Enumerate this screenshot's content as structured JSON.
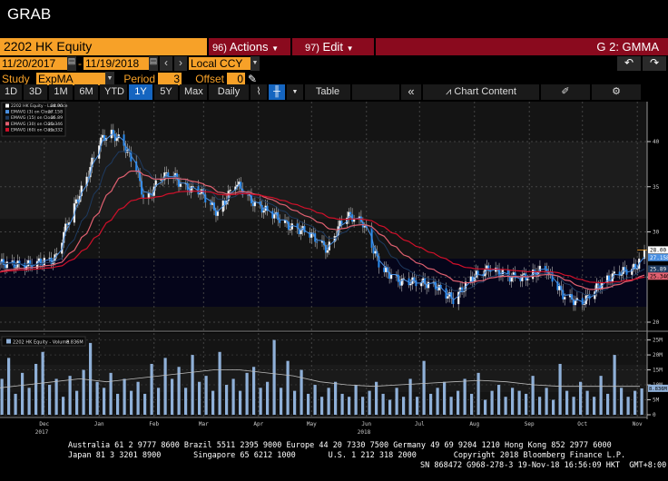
{
  "window_title": "GRAB",
  "header": {
    "ticker": "2202 HK Equity",
    "actions_num": "96)",
    "actions_label": "Actions",
    "edit_num": "97)",
    "edit_label": "Edit",
    "function": "G 2: GMMA"
  },
  "range": {
    "start": "11/20/2017",
    "dash": "-",
    "end": "11/19/2018",
    "currency": "Local CCY"
  },
  "study": {
    "label": "Study",
    "value": "ExpMA",
    "period_label": "Period",
    "period": "3",
    "offset_label": "Offset",
    "offset": "0"
  },
  "toolbar": {
    "periods": [
      "1D",
      "3D",
      "1M",
      "6M",
      "YTD",
      "1Y",
      "5Y",
      "Max"
    ],
    "selected": "1Y",
    "frequency": "Daily ▼",
    "table": "Table",
    "collapse": "«",
    "chart_content": "Chart Content"
  },
  "legend": {
    "items": [
      {
        "label": "2202 HK Equity - Last Price",
        "value": "28.00",
        "color": "#ffffff"
      },
      {
        "label": "EMAVG (3) on Close",
        "value": "27.158",
        "color": "#4a90e2"
      },
      {
        "label": "EMAVG (15) on Close",
        "value": "25.89",
        "color": "#1e3a5f"
      },
      {
        "label": "EMAVG (30) on Close",
        "value": "25.346",
        "color": "#e06070"
      },
      {
        "label": "EMAVG (60) on Close",
        "value": "25.332",
        "color": "#d0102a"
      }
    ]
  },
  "volume_legend": {
    "label": "2202 HK Equity - Volume",
    "value": "8.836M",
    "color": "#8fb0d8"
  },
  "chart_data": {
    "type": "candlestick",
    "price_axis": {
      "ticks": [
        "20",
        "25",
        "30",
        "35",
        "40"
      ],
      "ylim": [
        19,
        43
      ]
    },
    "volume_axis": {
      "ticks": [
        "0",
        "5M",
        "10M",
        "15M",
        "20M",
        "25M"
      ],
      "ylim": [
        0,
        27
      ]
    },
    "x_labels": [
      {
        "m": "Dec",
        "y": "2017",
        "d": "2017-12-15"
      },
      {
        "m": "Jan",
        "d": "2018-01-15"
      },
      {
        "m": "Feb",
        "d": "2018-02-15"
      },
      {
        "m": "Mar",
        "d": "2018-03-15"
      },
      {
        "m": "Apr",
        "d": "2018-04-15"
      },
      {
        "m": "May",
        "d": "2018-05-15"
      },
      {
        "m": "Jun",
        "y": "2018",
        "d": "2018-06-15"
      },
      {
        "m": "Jul",
        "d": "2018-07-15"
      },
      {
        "m": "Aug",
        "d": "2018-08-15"
      },
      {
        "m": "Sep",
        "d": "2018-09-15"
      },
      {
        "m": "Oct",
        "d": "2018-10-15"
      },
      {
        "m": "Nov",
        "d": "2018-11-15"
      }
    ],
    "x_range": [
      "2017-11-20",
      "2018-11-19"
    ],
    "close": [
      [
        "2017-11-20",
        26.5
      ],
      [
        "2017-12-05",
        26.3
      ],
      [
        "2017-12-21",
        27
      ],
      [
        "2017-12-28",
        31
      ],
      [
        "2018-01-08",
        36
      ],
      [
        "2018-01-15",
        40
      ],
      [
        "2018-01-21",
        41
      ],
      [
        "2018-01-28",
        40
      ],
      [
        "2018-02-05",
        37
      ],
      [
        "2018-02-10",
        33
      ],
      [
        "2018-02-18",
        36
      ],
      [
        "2018-02-25",
        36.5
      ],
      [
        "2018-03-03",
        35
      ],
      [
        "2018-03-13",
        34.5
      ],
      [
        "2018-03-23",
        32
      ],
      [
        "2018-04-02",
        35.5
      ],
      [
        "2018-04-13",
        33
      ],
      [
        "2018-04-23",
        32
      ],
      [
        "2018-05-03",
        30.5
      ],
      [
        "2018-05-13",
        30
      ],
      [
        "2018-05-24",
        28
      ],
      [
        "2018-06-03",
        32
      ],
      [
        "2018-06-13",
        31
      ],
      [
        "2018-06-23",
        26
      ],
      [
        "2018-07-04",
        24.5
      ],
      [
        "2018-07-14",
        24.5
      ],
      [
        "2018-07-24",
        24
      ],
      [
        "2018-08-03",
        22.5
      ],
      [
        "2018-08-14",
        25
      ],
      [
        "2018-08-24",
        26
      ],
      [
        "2018-09-03",
        25
      ],
      [
        "2018-09-13",
        25
      ],
      [
        "2018-09-24",
        26
      ],
      [
        "2018-10-04",
        23
      ],
      [
        "2018-10-14",
        22
      ],
      [
        "2018-10-24",
        24
      ],
      [
        "2018-11-04",
        25.5
      ],
      [
        "2018-11-14",
        26
      ],
      [
        "2018-11-19",
        28
      ]
    ],
    "volume_M": [
      12,
      19,
      7,
      14,
      9,
      17,
      21,
      10,
      12,
      6,
      13,
      8,
      15,
      24,
      11,
      9,
      14,
      7,
      12,
      8,
      11,
      7,
      17,
      9,
      19,
      12,
      16,
      9,
      20,
      11,
      13,
      8,
      21,
      10,
      12,
      8,
      14,
      16,
      9,
      11,
      25,
      9,
      18,
      8,
      15,
      7,
      10,
      6,
      9,
      11,
      7,
      6,
      10,
      6,
      8,
      11,
      7,
      5,
      9,
      6,
      12,
      6,
      18,
      7,
      9,
      11,
      6,
      8,
      12,
      7,
      14,
      5,
      8,
      10,
      6,
      9,
      8,
      7,
      13,
      6,
      9,
      5,
      17,
      8,
      6,
      11,
      8,
      6,
      13,
      7,
      20,
      9,
      6,
      8,
      8.8
    ],
    "volume_ma_M": [
      9,
      10,
      11,
      12,
      11,
      12,
      13,
      14,
      15,
      15,
      14,
      13,
      11,
      10,
      9.5,
      10,
      10.5,
      11,
      11.5,
      11,
      10,
      9.5,
      9.5,
      9.5,
      9.5
    ]
  },
  "footer": {
    "line1": "Australia 61 2 9777 8600 Brazil 5511 2395 9000 Europe 44 20 7330 7500 Germany 49 69 9204 1210 Hong Kong 852 2977 6000",
    "line2": "Japan 81 3 3201 8900       Singapore 65 6212 1000       U.S. 1 212 318 2000        Copyright 2018 Bloomberg Finance L.P.",
    "line3": "SN 868472 G968-278-3 19-Nov-18 16:56:09 HKT  GMT+8:00"
  }
}
